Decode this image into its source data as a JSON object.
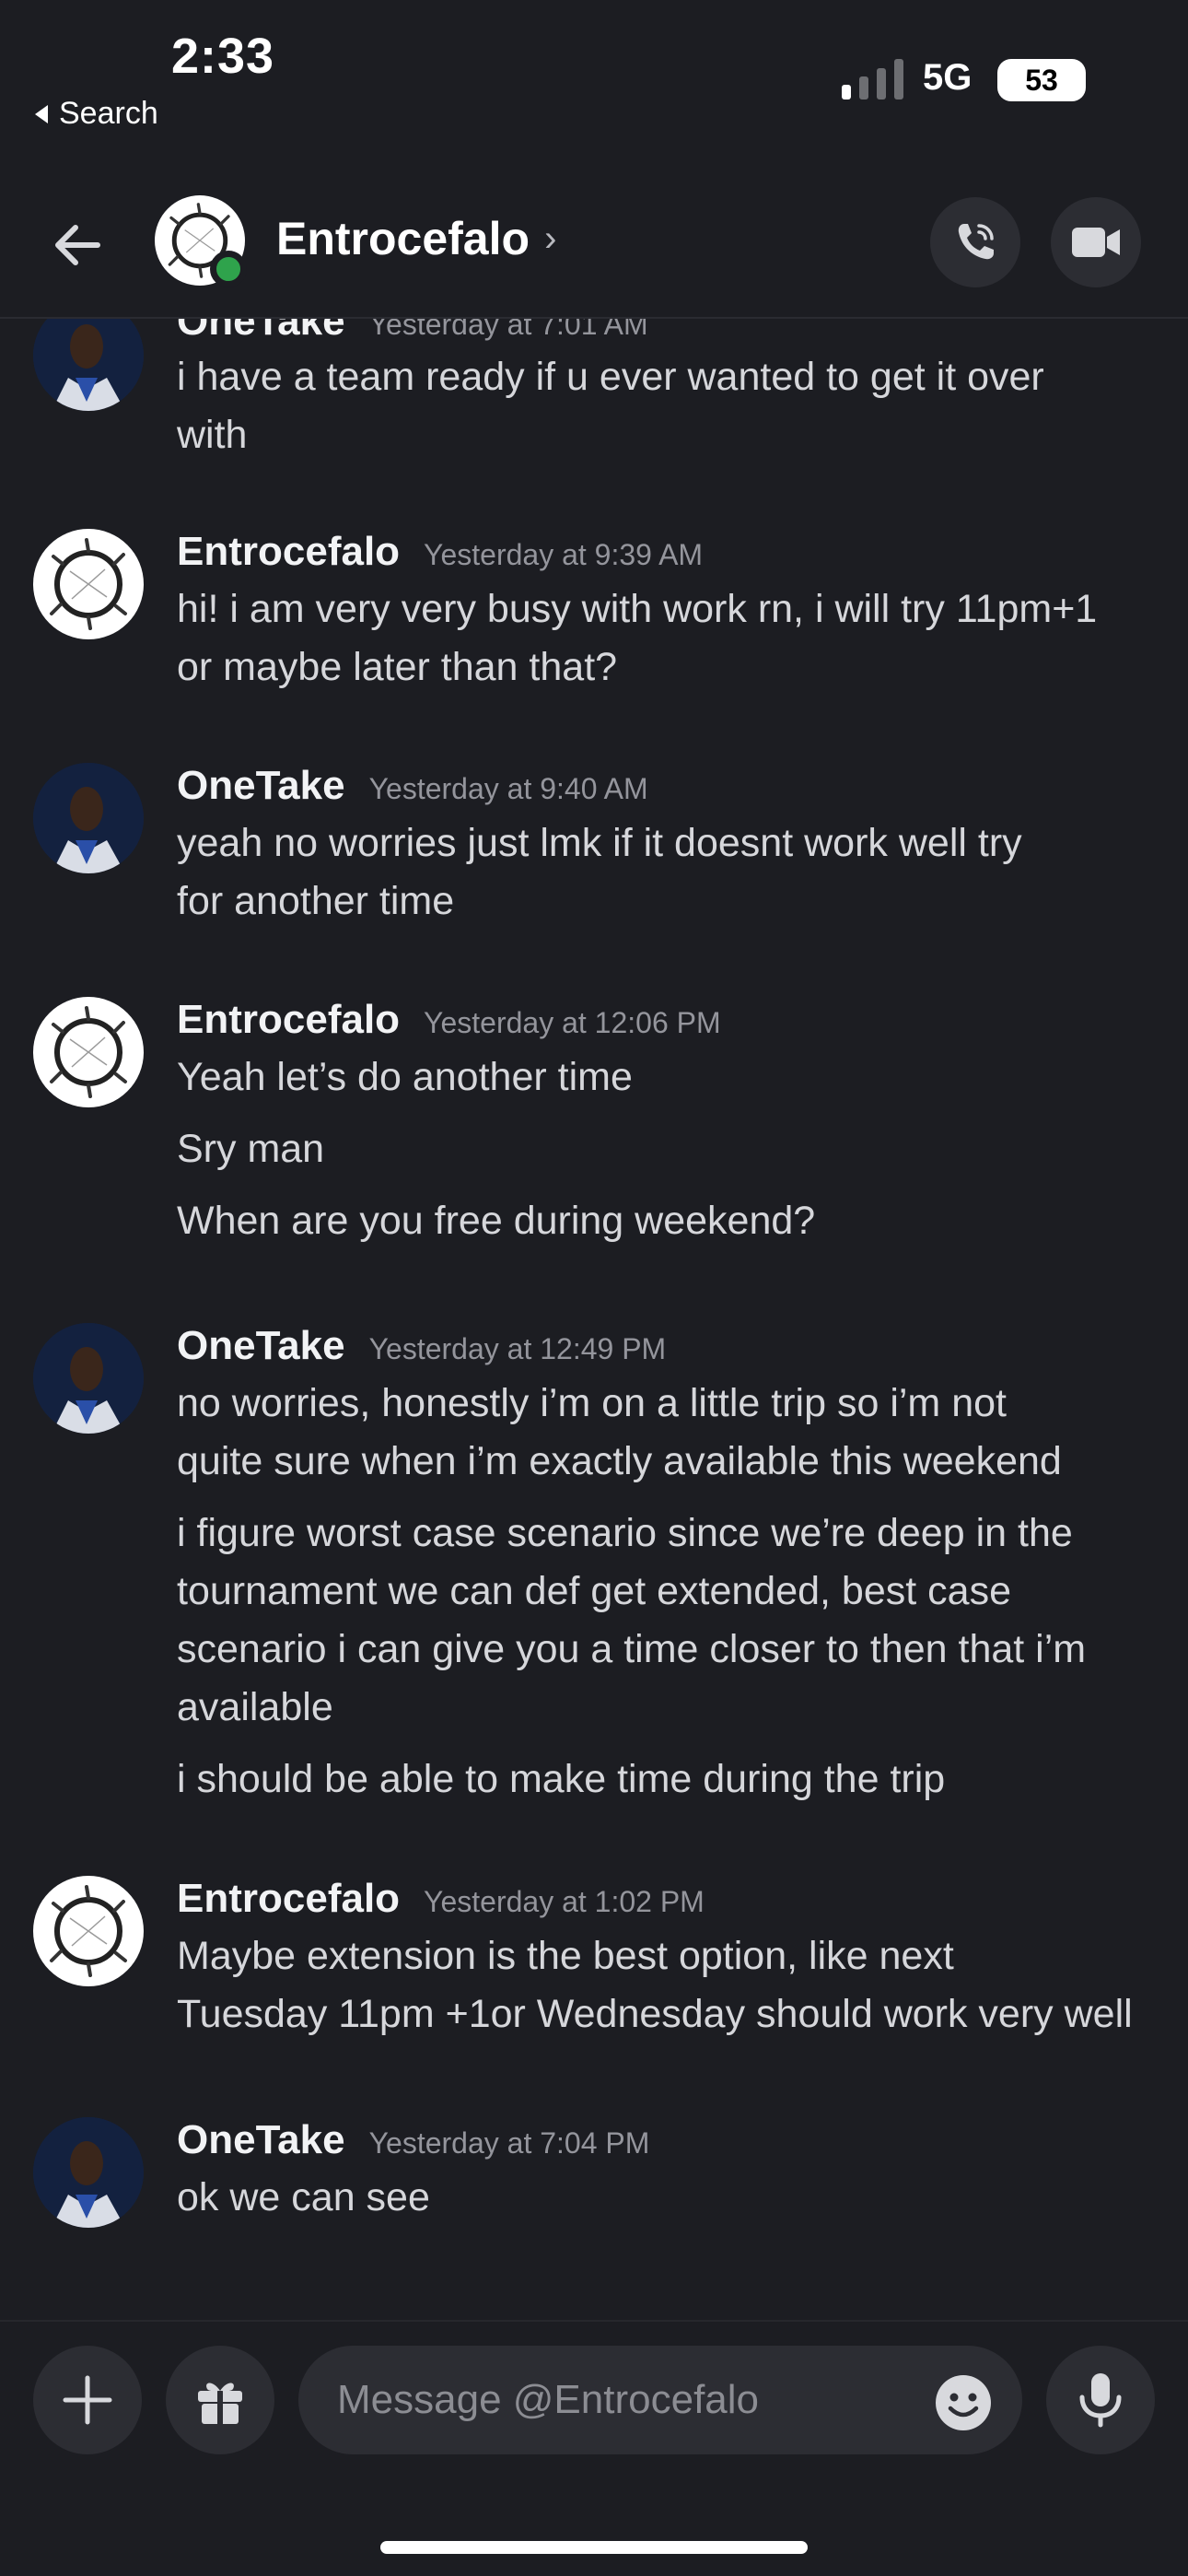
{
  "status_bar": {
    "time": "2:33",
    "back_label": "Search",
    "network": "5G",
    "battery": "53"
  },
  "header": {
    "contact_name": "Entrocefalo"
  },
  "messages": [
    {
      "author": "OneTake",
      "timestamp": "Yesterday at 7:01 AM",
      "lines": [
        "i have a team ready if u ever wanted to get it over",
        "with"
      ]
    },
    {
      "author": "Entrocefalo",
      "timestamp": "Yesterday at 9:39 AM",
      "lines": [
        "hi! i am very very busy with work rn, i will try 11pm+1",
        "or maybe later than that?"
      ]
    },
    {
      "author": "OneTake",
      "timestamp": "Yesterday at 9:40 AM",
      "lines": [
        "yeah no worries just lmk if it doesnt work well try",
        "for another time"
      ]
    },
    {
      "author": "Entrocefalo",
      "timestamp": "Yesterday at 12:06 PM",
      "lines": [
        "Yeah let’s do another time",
        "Sry man",
        "When are you free during weekend?"
      ]
    },
    {
      "author": "OneTake",
      "timestamp": "Yesterday at 12:49 PM",
      "lines": [
        "no worries, honestly i’m on a little trip so i’m not",
        "quite sure when i’m exactly available this weekend",
        "i figure worst case scenario since we’re deep in the",
        "tournament we can def get extended, best case",
        "scenario i can give you a time closer to then that i’m",
        "available",
        "i should be able to make time during the trip"
      ]
    },
    {
      "author": "Entrocefalo",
      "timestamp": "Yesterday at 1:02 PM",
      "lines": [
        "Maybe extension is the best option, like next",
        "Tuesday 11pm +1or Wednesday should work very well"
      ]
    },
    {
      "author": "OneTake",
      "timestamp": "Yesterday at 7:04 PM",
      "lines": [
        "ok we can see"
      ]
    }
  ],
  "composer": {
    "placeholder": "Message @Entrocefalo"
  },
  "icons": {
    "back": "arrow-left-icon",
    "call": "phone-icon",
    "video": "video-camera-icon",
    "plus": "plus-icon",
    "gift": "gift-icon",
    "emoji": "emoji-icon",
    "mic": "microphone-icon"
  },
  "colors": {
    "background": "#1c1d22",
    "online": "#2fa34c",
    "button": "#2c2d33"
  }
}
